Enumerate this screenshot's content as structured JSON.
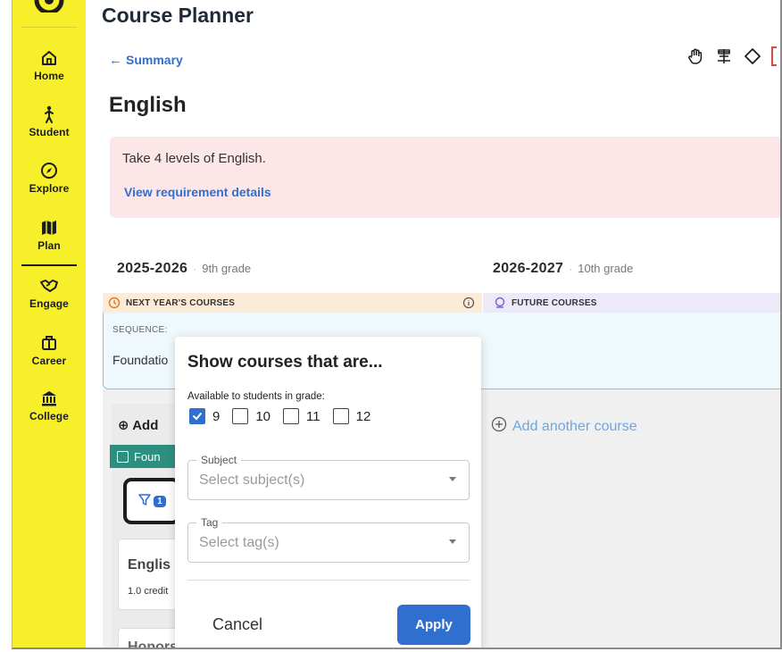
{
  "sidebar": {
    "items": [
      {
        "label": "Home",
        "icon": "home-icon"
      },
      {
        "label": "Student",
        "icon": "student-icon"
      },
      {
        "label": "Explore",
        "icon": "compass-icon"
      },
      {
        "label": "Plan",
        "icon": "map-icon",
        "active": true
      },
      {
        "label": "Engage",
        "icon": "handshake-icon"
      },
      {
        "label": "Career",
        "icon": "briefcase-icon"
      },
      {
        "label": "College",
        "icon": "bank-icon"
      }
    ]
  },
  "header": {
    "title": "Course Planner",
    "back_label": "Summary",
    "toolbar_icons": [
      "hand-icon",
      "list-icon",
      "diamond-icon"
    ]
  },
  "section": {
    "title": "English",
    "requirement_text": "Take 4 levels of English.",
    "requirement_link": "View requirement details"
  },
  "years": [
    {
      "title": "2025-2026",
      "grade": "9th grade",
      "column_label": "NEXT YEAR'S COURSES"
    },
    {
      "title": "2026-2027",
      "grade": "10th grade",
      "column_label": "FUTURE COURSES"
    }
  ],
  "sequence": {
    "label": "SEQUENCE:",
    "value": "Foundatio"
  },
  "left_column": {
    "add_label": "Add",
    "teal_label": "Foun",
    "filter_badge": "1",
    "course_name": "Englis",
    "course_credits": "1.0 credit",
    "course_name_2": "Honors"
  },
  "right_column": {
    "add_another": "Add another course"
  },
  "popover": {
    "title": "Show courses that are...",
    "grade_label": "Available to students in grade:",
    "grades": [
      {
        "label": "9",
        "checked": true
      },
      {
        "label": "10",
        "checked": false
      },
      {
        "label": "11",
        "checked": false
      },
      {
        "label": "12",
        "checked": false
      }
    ],
    "subject": {
      "legend": "Subject",
      "placeholder": "Select subject(s)"
    },
    "tag": {
      "legend": "Tag",
      "placeholder": "Select tag(s)"
    },
    "cancel_label": "Cancel",
    "apply_label": "Apply"
  },
  "colors": {
    "sidebar": "#f7ef2a",
    "accent": "#2f6fd0",
    "banner": "#fde6e8",
    "teal": "#2e8e80"
  }
}
